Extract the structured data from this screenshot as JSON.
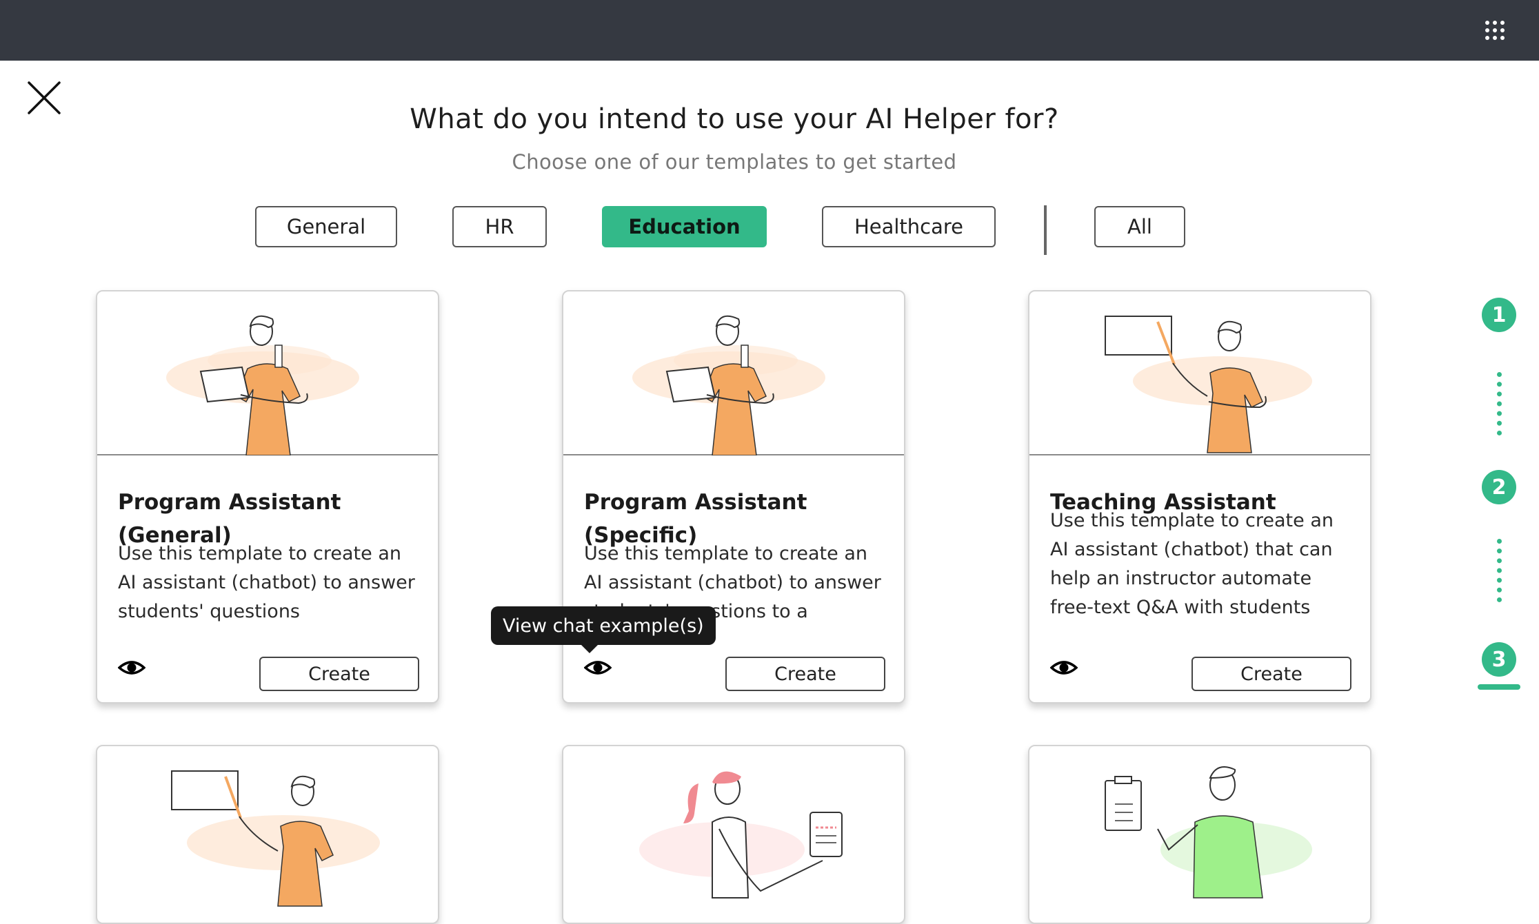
{
  "heading": {
    "title": "What do you intend to use your AI Helper for?",
    "subtitle": "Choose one of our templates to get started"
  },
  "filters": [
    {
      "label": "General",
      "active": false
    },
    {
      "label": "HR",
      "active": false
    },
    {
      "label": "Education",
      "active": true
    },
    {
      "label": "Healthcare",
      "active": false
    },
    {
      "label": "All",
      "active": false
    }
  ],
  "cards": [
    {
      "title": "Program Assistant (General)",
      "description": "Use this template to create an AI assistant (chatbot) to answer students' questions",
      "create_label": "Create"
    },
    {
      "title": "Program Assistant (Specific)",
      "description": "Use this template to create an AI assistant (chatbot) to answer students' questions to a",
      "create_label": "Create"
    },
    {
      "title": "Teaching Assistant",
      "description": "Use this template to create an AI assistant (chatbot) that can help an instructor automate free-text Q&A with students",
      "create_label": "Create"
    }
  ],
  "tooltip": "View chat example(s)",
  "steps": [
    "1",
    "2",
    "3"
  ],
  "colors": {
    "accent": "#33b989",
    "topbar": "#353941",
    "illustration_orange": "#f4a861",
    "illustration_green": "#9ef08a",
    "illustration_pink": "#f08a91"
  },
  "icons": {
    "apps": "grid-icon",
    "close": "close-icon",
    "preview": "eye-icon"
  }
}
